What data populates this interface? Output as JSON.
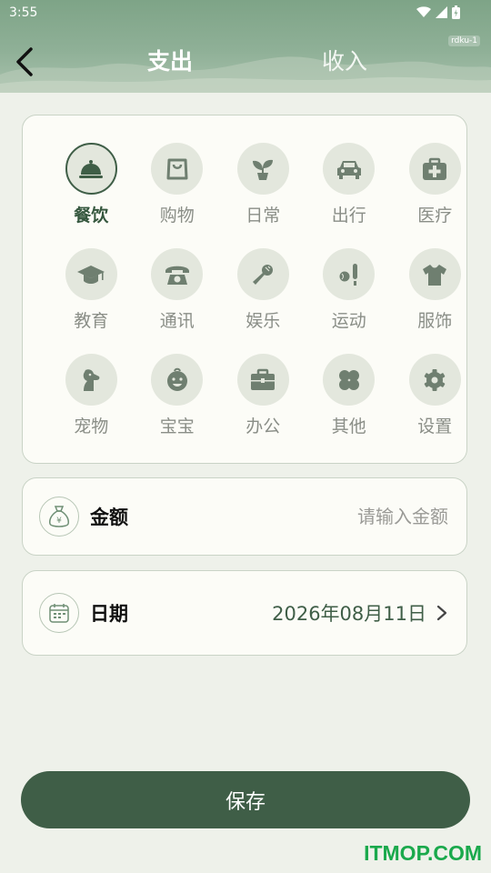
{
  "status": {
    "time": "3:55"
  },
  "header": {
    "tab_expense": "支出",
    "tab_income": "收入",
    "tag": "rdku-1"
  },
  "categories": [
    {
      "label": "餐饮",
      "icon": "cloche-icon"
    },
    {
      "label": "购物",
      "icon": "shopping-bag-icon"
    },
    {
      "label": "日常",
      "icon": "plant-icon"
    },
    {
      "label": "出行",
      "icon": "car-icon"
    },
    {
      "label": "医疗",
      "icon": "medical-kit-icon"
    },
    {
      "label": "教育",
      "icon": "graduation-cap-icon"
    },
    {
      "label": "通讯",
      "icon": "telephone-icon"
    },
    {
      "label": "娱乐",
      "icon": "microphone-icon"
    },
    {
      "label": "运动",
      "icon": "baseball-icon"
    },
    {
      "label": "服饰",
      "icon": "shirt-icon"
    },
    {
      "label": "宠物",
      "icon": "dog-icon"
    },
    {
      "label": "宝宝",
      "icon": "baby-face-icon"
    },
    {
      "label": "办公",
      "icon": "briefcase-icon"
    },
    {
      "label": "其他",
      "icon": "clover-icon"
    },
    {
      "label": "设置",
      "icon": "gear-icon"
    }
  ],
  "amount": {
    "label": "金额",
    "placeholder": "请输入金额"
  },
  "date": {
    "label": "日期",
    "value": "2026年08月11日"
  },
  "save_label": "保存",
  "watermark": "ITMOP.COM",
  "colors": {
    "accent": "#3f5e47",
    "icon_bg": "#e3e7dd",
    "icon_fg": "#6f7f70"
  }
}
